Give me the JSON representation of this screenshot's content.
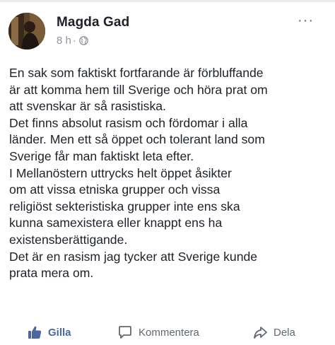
{
  "post": {
    "author": "Magda Gad",
    "time": "8 h",
    "separator": "·",
    "privacy_icon": "globe-icon",
    "more_label": "···",
    "lines": [
      "En sak som faktiskt fortfarande är förbluffande",
      "är att komma hem till Sverige och höra prat om",
      "att svenskar är så rasistiska.",
      "Det finns absolut rasism och fördomar i alla",
      "länder. Men ett så öppet och tolerant land som",
      "Sverige får man faktiskt leta efter.",
      "I Mellanöstern uttrycks helt öppet åsikter",
      "om att vissa etniska grupper och vissa",
      "religiöst sekteristiska grupper inte ens ska",
      "kunna samexistera eller knappt ens ha",
      "existensberättigande.",
      "Det är en rasism jag tycker att Sverige kunde",
      "prata mera om."
    ]
  },
  "actions": {
    "like_label": "Gilla",
    "comment_label": "Kommentera",
    "share_label": "Dela"
  },
  "colors": {
    "text": "#1d2129",
    "meta": "#90949c",
    "like_blue": "#4b67a1",
    "action_gray": "#606770"
  }
}
